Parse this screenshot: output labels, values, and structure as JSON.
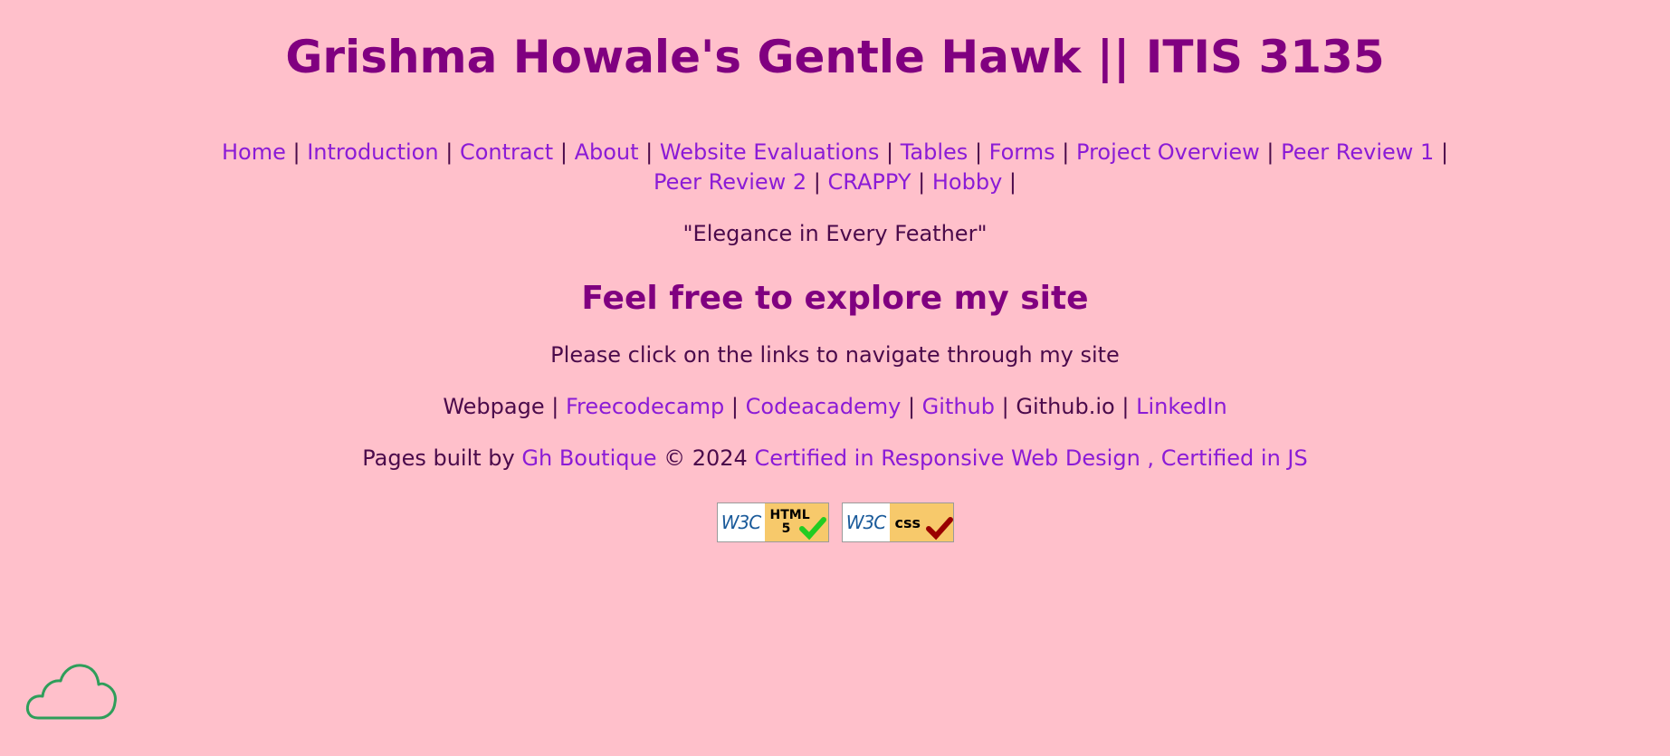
{
  "header": {
    "title": "Grishma Howale's Gentle Hawk || ITIS 3135"
  },
  "nav": {
    "row1": [
      "Home",
      "Introduction",
      "Contract",
      "About",
      "Website Evaluations",
      "Tables",
      "Forms",
      "Project Overview",
      "Peer Review 1"
    ],
    "row2": [
      "Peer Review 2",
      "CRAPPY",
      "Hobby"
    ]
  },
  "motto": "\"Elegance in Every Feather\"",
  "main": {
    "heading": "Feel free to explore my site",
    "instruction": "Please click on the links to navigate through my site"
  },
  "links": {
    "webpage": "Webpage",
    "freecodecamp": "Freecodecamp",
    "codeacademy": "Codeacademy",
    "github": "Github",
    "githubio": "Github.io",
    "linkedin": "LinkedIn"
  },
  "footer": {
    "prefix": "Pages built by",
    "brand": "Gh Boutique",
    "year": "© 2024",
    "cert1": "Certified in Responsive Web Design",
    "comma": ",",
    "cert2": "Certified in JS"
  },
  "badges": {
    "html": {
      "w3c": "W3C",
      "label": "HTML 5"
    },
    "css": {
      "w3c": "W3C",
      "label": "css"
    }
  },
  "colors": {
    "background": "#ffc0cb",
    "heading": "#800080",
    "link": "#8b1bd6",
    "cloud": "#2e9e5a"
  }
}
